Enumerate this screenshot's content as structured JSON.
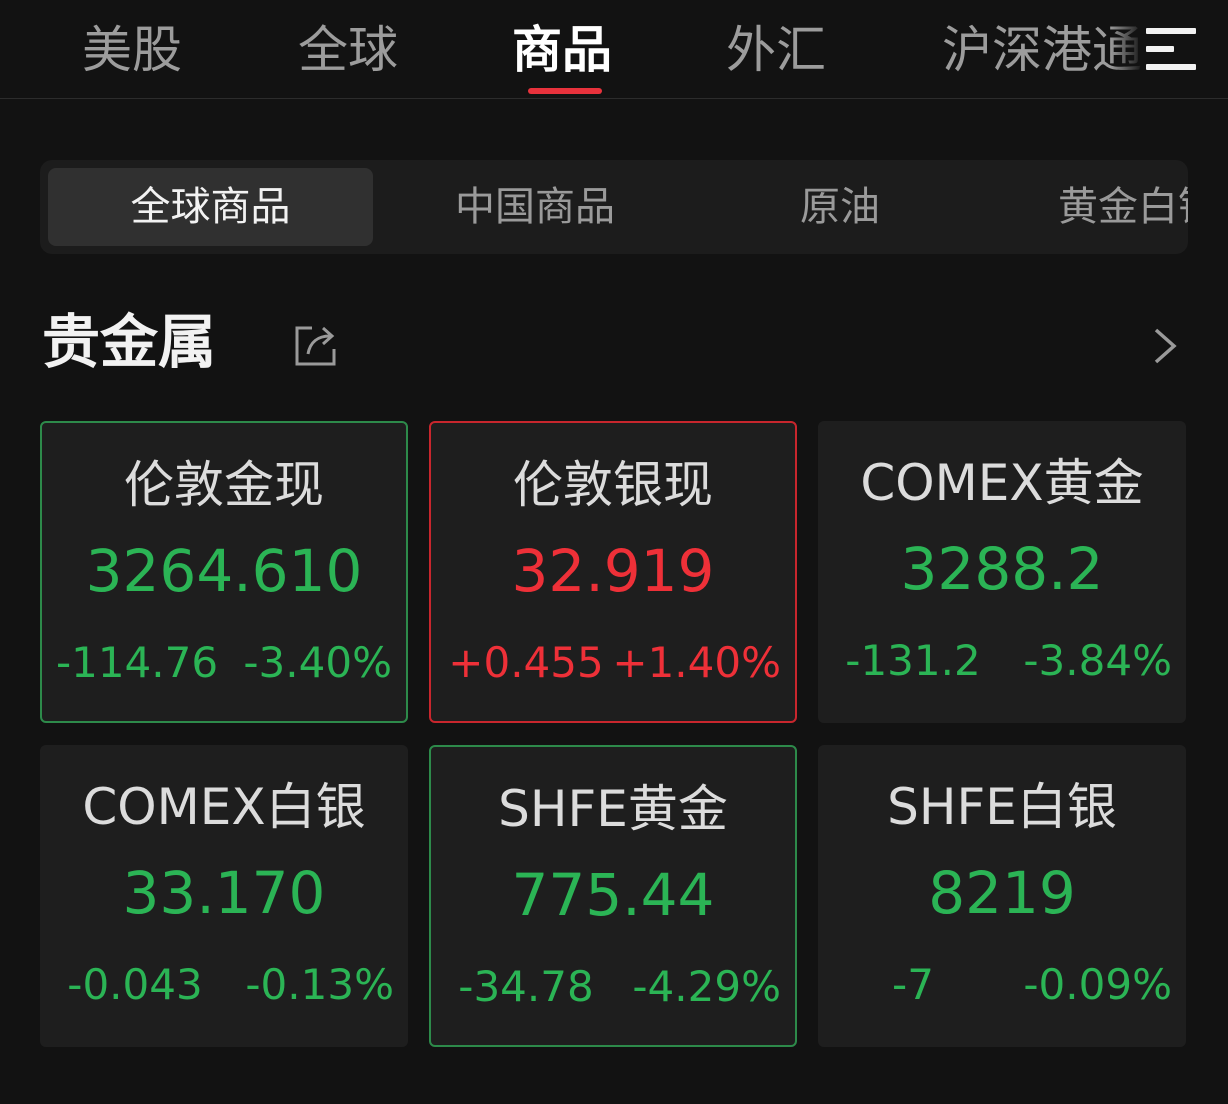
{
  "top_tabs": [
    {
      "label": "美股"
    },
    {
      "label": "全球"
    },
    {
      "label": "商品"
    },
    {
      "label": "外汇"
    },
    {
      "label": "沪深港通"
    }
  ],
  "top_tabs_active": "商品",
  "sub_tabs": [
    {
      "label": "全球商品"
    },
    {
      "label": "中国商品"
    },
    {
      "label": "原油"
    },
    {
      "label": "黄金白银"
    }
  ],
  "sub_tabs_active": "全球商品",
  "section": {
    "title": "贵金属"
  },
  "icons": {
    "menu": "menu-icon",
    "share": "share-icon",
    "more": "chevron-right-icon"
  },
  "colors": {
    "up": "#ee3038",
    "down": "#2bb455",
    "accent": "#e8323c"
  },
  "quotes": [
    {
      "name": "伦敦金现",
      "price": "3264.610",
      "change": "-114.76",
      "pct": "-3.40%",
      "direction": "down"
    },
    {
      "name": "伦敦银现",
      "price": "32.919",
      "change": "+0.455",
      "pct": "+1.40%",
      "direction": "up"
    },
    {
      "name": "COMEX黄金",
      "price": "3288.2",
      "change": "-131.2",
      "pct": "-3.84%",
      "direction": "down"
    },
    {
      "name": "COMEX白银",
      "price": "33.170",
      "change": "-0.043",
      "pct": "-0.13%",
      "direction": "down"
    },
    {
      "name": "SHFE黄金",
      "price": "775.44",
      "change": "-34.78",
      "pct": "-4.29%",
      "direction": "down"
    },
    {
      "name": "SHFE白银",
      "price": "8219",
      "change": "-7",
      "pct": "-0.09%",
      "direction": "down"
    }
  ]
}
